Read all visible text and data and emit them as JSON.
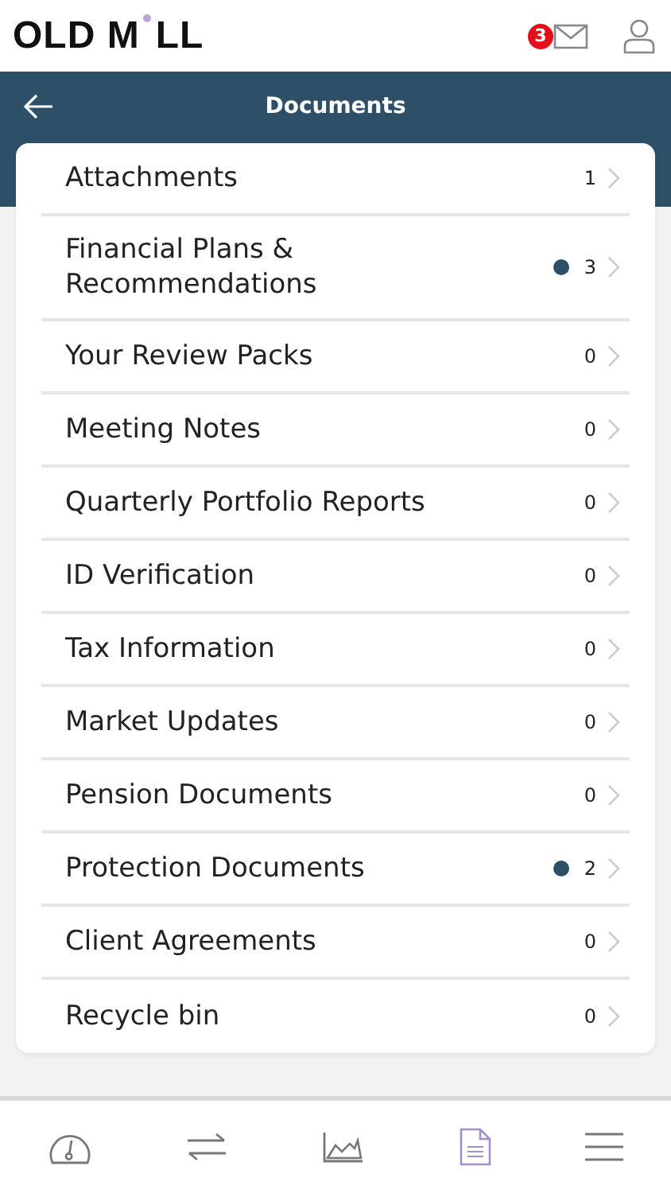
{
  "header": {
    "logo": [
      "OLD M",
      "LL"
    ],
    "unread_badge": "3"
  },
  "title_bar": {
    "title": "Documents"
  },
  "documents": [
    {
      "label": "Attachments",
      "count": "1",
      "unread": false
    },
    {
      "label": "Financial Plans & Recommendations",
      "count": "3",
      "unread": true
    },
    {
      "label": "Your Review Packs",
      "count": "0",
      "unread": false
    },
    {
      "label": "Meeting Notes",
      "count": "0",
      "unread": false
    },
    {
      "label": "Quarterly Portfolio Reports",
      "count": "0",
      "unread": false
    },
    {
      "label": "ID Verification",
      "count": "0",
      "unread": false
    },
    {
      "label": "Tax Information",
      "count": "0",
      "unread": false
    },
    {
      "label": "Market Updates",
      "count": "0",
      "unread": false
    },
    {
      "label": "Pension Documents",
      "count": "0",
      "unread": false
    },
    {
      "label": "Protection Documents",
      "count": "2",
      "unread": true
    },
    {
      "label": "Client Agreements",
      "count": "0",
      "unread": false
    },
    {
      "label": "Recycle bin",
      "count": "0",
      "unread": false
    }
  ],
  "bottom_nav": [
    {
      "kind": "dashboard",
      "selected": false
    },
    {
      "kind": "transfers",
      "selected": false
    },
    {
      "kind": "chart",
      "selected": false
    },
    {
      "kind": "documents",
      "selected": true
    },
    {
      "kind": "menu",
      "selected": false
    }
  ]
}
